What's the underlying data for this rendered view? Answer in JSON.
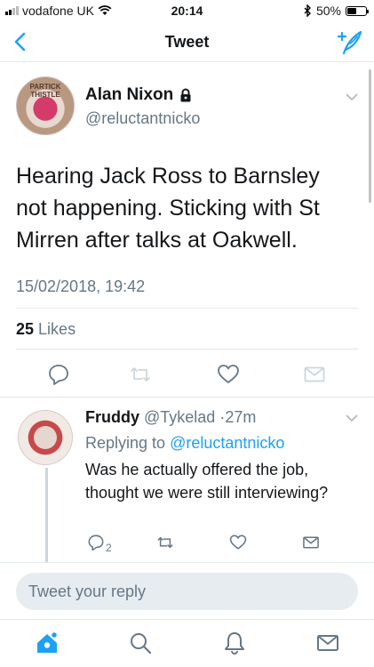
{
  "status_bar": {
    "carrier": "vodafone UK",
    "time": "20:14",
    "battery": "50%",
    "battery_level": 0.5
  },
  "nav": {
    "title": "Tweet"
  },
  "tweet": {
    "author_name": "Alan Nixon",
    "handle": "@reluctantnicko",
    "avatar_text": "PARTICK THISTLE",
    "text": "Hearing Jack Ross to Barnsley not happening. Sticking with St Mirren after talks at Oakwell.",
    "timestamp": "15/02/2018, 19:42",
    "likes_count": "25",
    "likes_label": "Likes"
  },
  "reply": {
    "author_name": "Fruddy",
    "handle": "@Tykelad",
    "separator": "·",
    "time": "27m",
    "replying_prefix": "Replying to",
    "replying_to": "@reluctantnicko",
    "text": "Was he actually offered the job, thought we were still interviewing?",
    "reply_count": "2"
  },
  "composer": {
    "placeholder": "Tweet your reply"
  },
  "colors": {
    "accent": "#1da1f2",
    "secondary_text": "#657786",
    "divider": "#e1e8ed"
  },
  "icons": {
    "nav_back": "chevron-left-icon",
    "compose": "compose-tweet-icon",
    "reply": "reply-icon",
    "retweet": "retweet-icon",
    "like": "heart-icon",
    "dm": "envelope-icon",
    "home": "home-icon",
    "search": "search-icon",
    "notifications": "bell-icon",
    "messages": "envelope-icon"
  }
}
